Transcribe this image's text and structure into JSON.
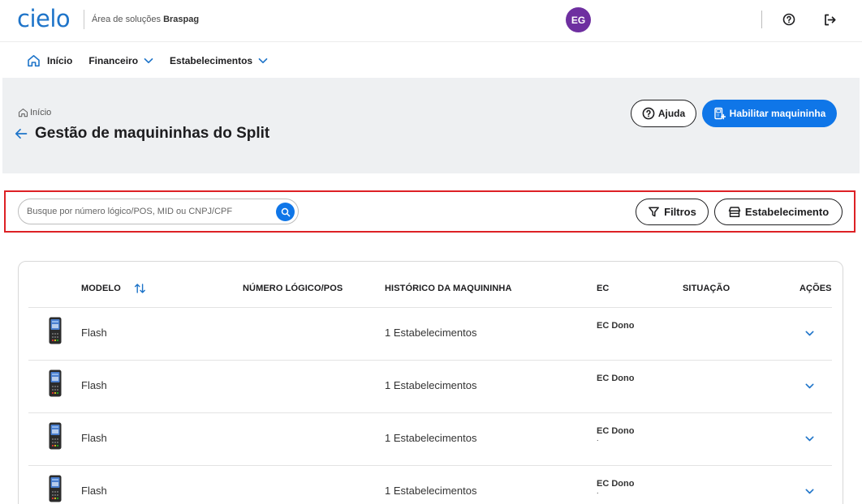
{
  "header": {
    "logo": "cielo",
    "subtitle_prefix": "Área de soluções",
    "subtitle_brand": "Braspag",
    "avatar_initials": "EG"
  },
  "nav": {
    "items": [
      {
        "label": "Início"
      },
      {
        "label": "Financeiro"
      },
      {
        "label": "Estabelecimentos"
      }
    ]
  },
  "page": {
    "breadcrumb": "Início",
    "title": "Gestão de maquininhas do Split",
    "help_button": "Ajuda",
    "primary_button": "Habilitar maquininha"
  },
  "filters": {
    "search_placeholder": "Busque por número lógico/POS, MID ou CNPJ/CPF",
    "filters_button": "Filtros",
    "establishment_button": "Estabelecimento"
  },
  "table": {
    "headers": {
      "model": "MODELO",
      "logical_number": "NÚMERO LÓGICO/POS",
      "history": "HISTÓRICO DA MAQUININHA",
      "ec": "EC",
      "status": "SITUAÇÃO",
      "actions": "AÇÕES"
    },
    "rows": [
      {
        "model": "Flash",
        "history": "1 Estabelecimentos",
        "ec": "EC Dono",
        "ec_sub": ""
      },
      {
        "model": "Flash",
        "history": "1 Estabelecimentos",
        "ec": "EC Dono",
        "ec_sub": ""
      },
      {
        "model": "Flash",
        "history": "1 Estabelecimentos",
        "ec": "EC Dono",
        "ec_sub": "."
      },
      {
        "model": "Flash",
        "history": "1 Estabelecimentos",
        "ec": "EC Dono",
        "ec_sub": "."
      }
    ]
  },
  "colors": {
    "brand_blue": "#1e74c9",
    "primary_button": "#0f76e8",
    "avatar_bg": "#6e2fa0",
    "highlight_frame": "#dd2125",
    "page_head_bg": "#eef0f2"
  },
  "icons": [
    "help-icon",
    "logout-icon",
    "home-icon",
    "chevron-down-icon",
    "arrow-left-icon",
    "search-icon",
    "filter-icon",
    "store-icon",
    "sort-icon",
    "pos-device-icon",
    "pos-add-icon"
  ]
}
